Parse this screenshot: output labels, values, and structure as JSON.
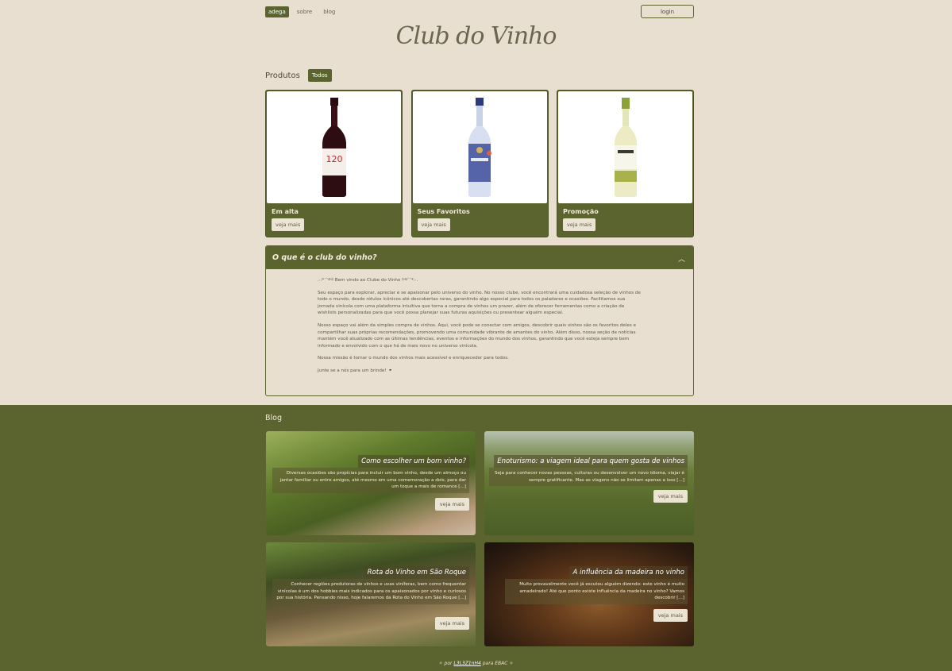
{
  "nav": {
    "items": [
      "adega",
      "sobre",
      "blog"
    ],
    "login_label": "login"
  },
  "brand": {
    "logo_text": "Club do Vinho"
  },
  "products": {
    "heading": "Produtos",
    "filter_label": "Todos",
    "cards": [
      {
        "title": "Em alta",
        "button": "veja mais",
        "label_text": "120"
      },
      {
        "title": "Seus Favoritos",
        "button": "veja mais"
      },
      {
        "title": "Promoção",
        "button": "veja mais"
      }
    ]
  },
  "about": {
    "heading": "O que é o club do vinho?",
    "paragraphs": [
      ".·:*¨༺ Bem vindo ao Clube do Vinho ༻¨*:·.",
      "Seu espaço para explorar, apreciar e se apaixonar pelo universo do vinho. No nosso clube, você encontrará uma cuidadosa seleção de vinhos de todo o mundo, desde rótulos icônicos até descobertas raras, garantindo algo especial para todos os paladares e ocasiões. Facilitamos sua jornada vinícola com uma plataforma intuitiva que torna a compra de vinhos um prazer, além de oferecer ferramentas como a criação de wishlists personalizadas para que você possa planejar suas futuras aquisições ou presentear alguém especial.",
      "Nosso espaço vai além da simples compra de vinhos. Aqui, você pode se conectar com amigos, descobrir quais vinhos são os favoritos deles e compartilhar suas próprias recomendações, promovendo uma comunidade vibrante de amantes do vinho. Além disso, nossa seção de notícias mantém você atualizado com as últimas tendências, eventos e informações do mundo dos vinhos, garantindo que você esteja sempre bem informado e envolvido com o que há de mais novo no universo vinícola.",
      "Nossa missão é tornar o mundo dos vinhos mais acessível e enriquecedor para todos.",
      "Junte se a nós para um brinde! 🍷"
    ]
  },
  "blog": {
    "heading": "Blog",
    "posts": [
      {
        "title": "Como escolher um bom vinho?",
        "excerpt": "Diversas ocasiões são propícias para incluir um bom vinho, desde um almoço ou jantar familiar ou entre amigos, até mesmo em uma comemoração a dois, para dar um toque a mais de romance [...]",
        "button": "veja mais"
      },
      {
        "title": "Enoturismo: a viagem ideal para quem gosta de vinhos",
        "excerpt": "Seja para conhecer novas pessoas, culturas ou desenvolver um novo idioma, viajar é sempre gratificante. Mas as viagens não se limitam apenas a isso [...]",
        "button": "veja mais"
      },
      {
        "title": "Rota do Vinho em São Roque",
        "excerpt": "Conhecer regiões produtoras de vinhos e uvas viníferas, bem como frequentar vinícolas é um dos hobbies mais indicados para os apaixonados por vinho e curiosos por sua história. Pensando nisso, hoje falaremos da Rota do Vinho em São Roque [...]",
        "button": "veja mais"
      },
      {
        "title": "A influência da madeira no vinho",
        "excerpt": "Muito provavelmente você já escutou alguém dizendo: este vinho é muito amadeirado! Até que ponto existe influência da madeira no vinho? Vamos descobrir [...]",
        "button": "veja mais"
      }
    ]
  },
  "footer": {
    "prefix": "✧ por",
    "author": "L3L3Z1nH4",
    "suffix": "para EBAC ✧"
  },
  "colors": {
    "olive": "#5b632e",
    "cream": "#e8dfd0"
  }
}
